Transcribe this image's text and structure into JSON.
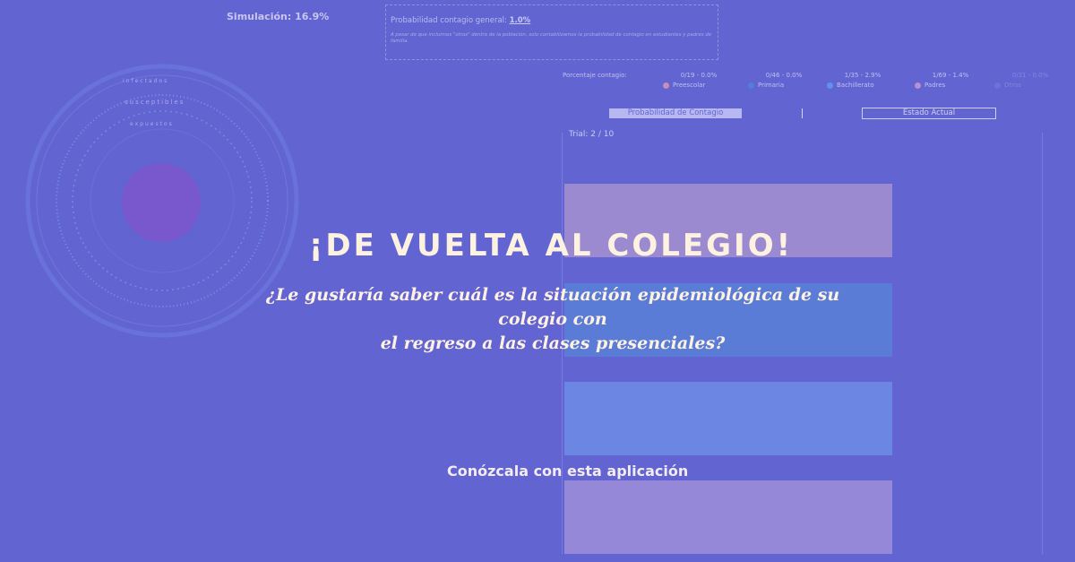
{
  "header": {
    "simulation_label": "Simulación: 16.9%"
  },
  "probability": {
    "title": "Probabilidad contagio general:",
    "value": "1.0%",
    "note": "A pesar de que incluimos \"otros\" dentro de la población, solo contabilizamos la probabilidad de contagio en estudiantes y padres de familia."
  },
  "legend": {
    "label": "Porcentaje contagio:",
    "items": [
      {
        "counts": "0/19 - 0.0%",
        "name": "Preescolar",
        "color": "#c58fb6"
      },
      {
        "counts": "0/46 - 0.0%",
        "name": "Primaria",
        "color": "#4f7fd8"
      },
      {
        "counts": "1/35 - 2.9%",
        "name": "Bachillerato",
        "color": "#5f94e6"
      },
      {
        "counts": "1/69 - 1.4%",
        "name": "Padres",
        "color": "#b98fce"
      },
      {
        "counts": "0/31 - 0.0%",
        "name": "Otros",
        "color": "#8a8ae0"
      }
    ]
  },
  "tabs": {
    "probability_label": "Probabilidad de Contagio",
    "state_label": "Estado Actual"
  },
  "trial": {
    "label": "Trial: 2 / 10"
  },
  "bars": [
    {
      "name": "preescolar",
      "color": "#9b8ad0",
      "fill": 1.0
    },
    {
      "name": "primaria",
      "color": "#5b7cd6",
      "fill": 1.0
    },
    {
      "name": "bachillerato",
      "color": "#6c86e3",
      "fill": 1.0
    },
    {
      "name": "padres",
      "color": "#9688d8",
      "fill": 1.0
    }
  ],
  "circle": {
    "ring_labels": [
      "susceptibles",
      "expuestos",
      "infectados"
    ]
  },
  "hero": {
    "headline": "¡DE VUELTA AL COLEGIO!",
    "subtitle_line1": "¿Le gustaría saber cuál es la situación epidemiológica de su colegio con",
    "subtitle_line2": "el regreso a las clases presenciales?",
    "cta": "Conózcala con esta aplicación"
  }
}
